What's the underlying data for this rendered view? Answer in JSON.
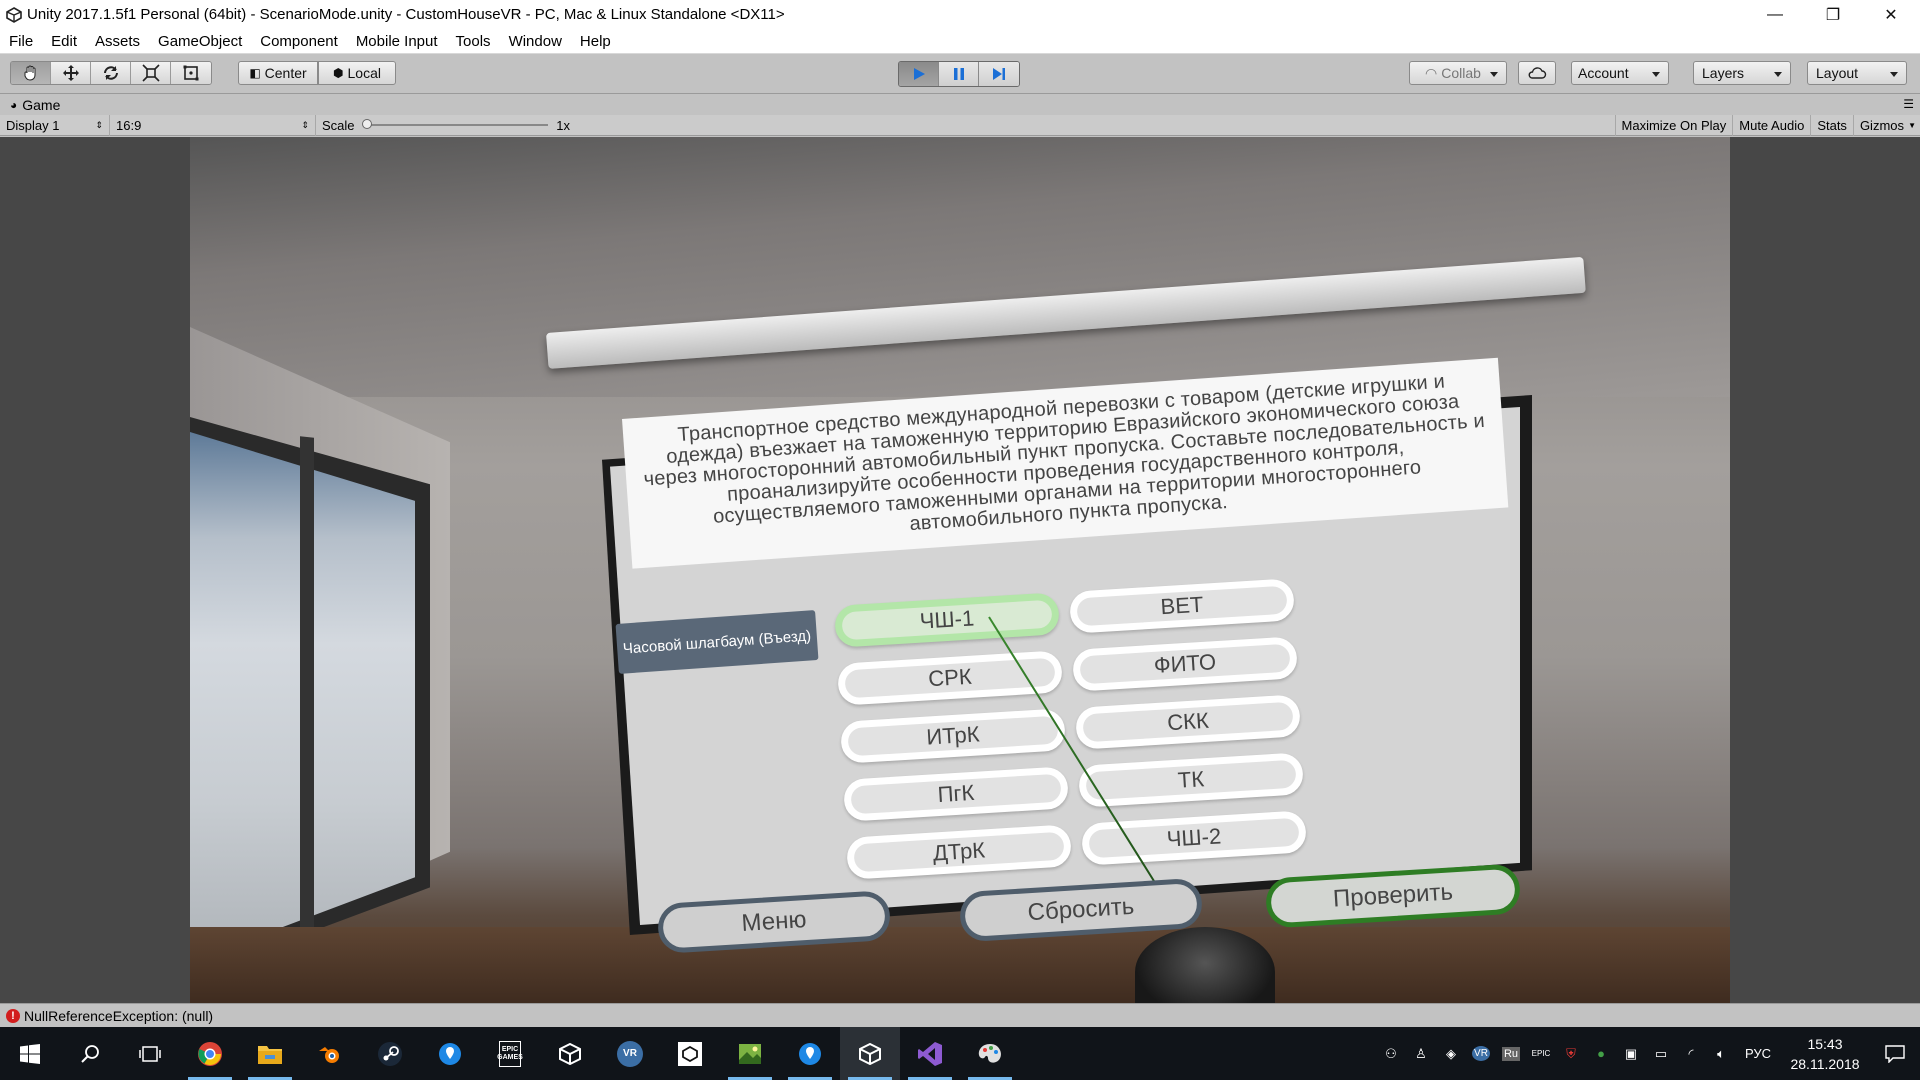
{
  "window": {
    "title": "Unity 2017.1.5f1 Personal (64bit) - ScenarioMode.unity - CustomHouseVR - PC, Mac & Linux Standalone <DX11>",
    "controls": [
      "—",
      "❐",
      "✕"
    ]
  },
  "menu": {
    "items": [
      "File",
      "Edit",
      "Assets",
      "GameObject",
      "Component",
      "Mobile Input",
      "Tools",
      "Window",
      "Help"
    ]
  },
  "toolbar": {
    "pivot_label": "Center",
    "space_label": "Local",
    "collab_label": "Collab",
    "account_label": "Account",
    "layers_label": "Layers",
    "layout_label": "Layout",
    "play_state": "playing"
  },
  "game_view": {
    "tab_label": "Game",
    "display": "Display 1",
    "aspect": "16:9",
    "scale_label": "Scale",
    "scale_value": "1x",
    "maximize_on_play": "Maximize On Play",
    "mute_audio": "Mute Audio",
    "stats": "Stats",
    "gizmos": "Gizmos"
  },
  "scene": {
    "question": "Транспортное средство международной перевозки с товаром (детские игрушки и одежда) въезжает на таможенную территорию Евразийского экономического союза через многосторонний автомобильный пункт пропуска. Составьте последовательность и проанализируйте особенности проведения государственного контроля, осуществляемого таможенными органами на территории многостороннего автомобильного пункта пропуска.",
    "step_label": "Часовой шлагбаум (Въезд)",
    "options_left": [
      "ЧШ-1",
      "СРК",
      "ИТрК",
      "ПгК",
      "ДТрК"
    ],
    "options_right": [
      "ВЕТ",
      "ФИТО",
      "СКК",
      "ТК",
      "ЧШ-2"
    ],
    "selected_option": "ЧШ-1",
    "menu_button": "Меню",
    "reset_button": "Сбросить",
    "check_button": "Проверить"
  },
  "status": {
    "message": "NullReferenceException: (null)"
  },
  "taskbar": {
    "language": "РУС",
    "time": "15:43",
    "date": "28.11.2018",
    "tray_lang_badge": "Ru",
    "tray_vr_badge": "VR"
  }
}
